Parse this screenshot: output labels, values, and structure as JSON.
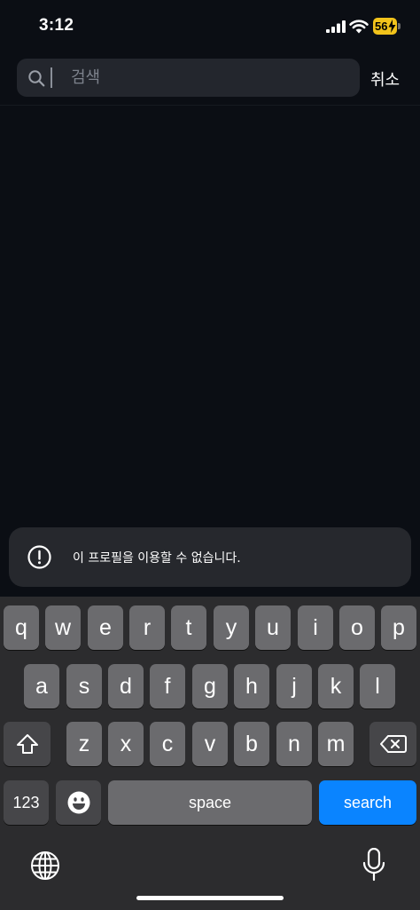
{
  "status_bar": {
    "time": "3:12",
    "battery_level": "56"
  },
  "search": {
    "placeholder": "검색",
    "cancel_label": "취소"
  },
  "toast": {
    "message": "이 프로필을 이용할 수 없습니다."
  },
  "keyboard": {
    "row1": [
      "q",
      "w",
      "e",
      "r",
      "t",
      "y",
      "u",
      "i",
      "o",
      "p"
    ],
    "row2": [
      "a",
      "s",
      "d",
      "f",
      "g",
      "h",
      "j",
      "k",
      "l"
    ],
    "row3": [
      "z",
      "x",
      "c",
      "v",
      "b",
      "n",
      "m"
    ],
    "numbers_label": "123",
    "space_label": "space",
    "search_label": "search",
    "accent_color": "#0a84ff"
  },
  "icons": [
    "search-icon",
    "signal-icon",
    "wifi-icon",
    "battery-icon",
    "alert-icon",
    "shift-icon",
    "backspace-icon",
    "emoji-icon",
    "globe-icon",
    "microphone-icon"
  ]
}
